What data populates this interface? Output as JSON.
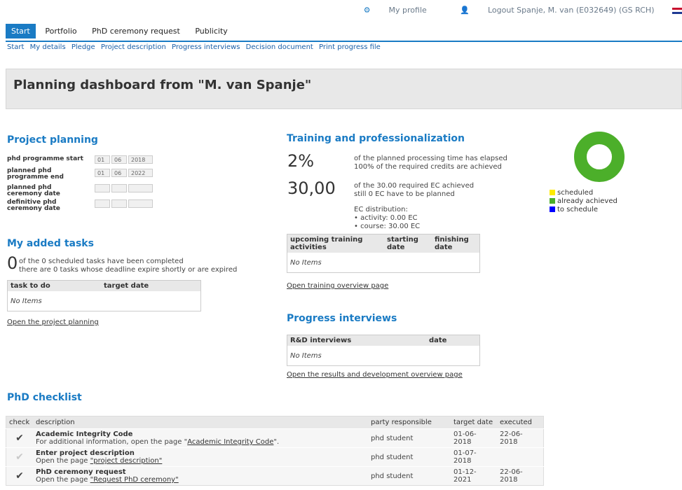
{
  "topbar": {
    "profile_label": "My profile",
    "logout_label": "Logout Spanje, M. van (E032649) (GS RCH)"
  },
  "tabs": [
    {
      "label": "Start"
    },
    {
      "label": "Portfolio"
    },
    {
      "label": "PhD ceremony request"
    },
    {
      "label": "Publicity"
    }
  ],
  "subnav": [
    "Start",
    "My details",
    "Pledge",
    "Project description",
    "Progress interviews",
    "Decision document",
    "Print progress file"
  ],
  "banner_title": "Planning dashboard from \"M. van Spanje\"",
  "project_planning": {
    "title": "Project planning",
    "rows": [
      {
        "label": "phd programme start",
        "d": "01",
        "m": "06",
        "y": "2018"
      },
      {
        "label": "planned phd programme end",
        "d": "01",
        "m": "06",
        "y": "2022"
      },
      {
        "label": "planned phd ceremony date",
        "d": "",
        "m": "",
        "y": ""
      },
      {
        "label": "definitive phd ceremony date",
        "d": "",
        "m": "",
        "y": ""
      }
    ]
  },
  "tasks": {
    "title": "My added tasks",
    "count": "0",
    "line1": "of the 0 scheduled tasks have been completed",
    "line2": "there are 0 tasks whose deadline expire shortly or are expired",
    "col1": "task to do",
    "col2": "target date",
    "no_items": "No Items",
    "link": "Open the project planning"
  },
  "training": {
    "title": "Training and professionalization",
    "pct": "2%",
    "pct_line1": "of the planned processing time has elapsed",
    "pct_line2": "100% of the required credits are achieved",
    "ec": "30,00",
    "ec_line1": "of the 30.00 required EC achieved",
    "ec_line2": "still 0 EC have to be planned",
    "dist_title": "EC distribution:",
    "dist_activity": "• activity: 0.00 EC",
    "dist_course": "• course:  30.00 EC",
    "col1": "upcoming training activities",
    "col2": "starting date",
    "col3": "finishing date",
    "no_items": "No Items",
    "link": "Open training overview page"
  },
  "chart_data": {
    "type": "pie",
    "categories": [
      "scheduled",
      "already achieved",
      "to schedule"
    ],
    "values": [
      0,
      100,
      0
    ],
    "colors": [
      "#ffeb00",
      "#4caf2a",
      "#0000ff"
    ],
    "legend": "right"
  },
  "progress": {
    "title": "Progress interviews",
    "col1": "R&D interviews",
    "col2": "date",
    "no_items": "No Items",
    "link": "Open the results and development overview page"
  },
  "checklist": {
    "title": "PhD checklist",
    "headers": [
      "check",
      "description",
      "party responsible",
      "target date",
      "executed"
    ],
    "rows": [
      {
        "title": "Academic Integrity Code",
        "pre": "For additional information, open the page \"",
        "link": "Academic Integrity Code",
        "post": "\".",
        "party": "phd student",
        "target": "01-06-2018",
        "executed": "22-06-2018"
      },
      {
        "title": "Enter project description",
        "pre": "Open the page ",
        "link": "\"project description\"",
        "post": "",
        "party": "phd student",
        "target": "01-07-2018",
        "executed": ""
      },
      {
        "title": "PhD ceremony request",
        "pre": "Open the page ",
        "link": "\"Request PhD ceremony\"",
        "post": "",
        "party": "phd student",
        "target": "01-12-2021",
        "executed": "22-06-2018"
      }
    ]
  }
}
